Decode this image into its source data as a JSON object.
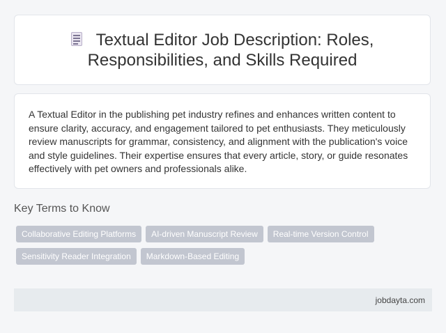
{
  "header": {
    "icon": "document-icon",
    "title": "Textual Editor Job Description: Roles, Responsibilities, and Skills Required"
  },
  "description": {
    "text": "A Textual Editor in the publishing pet industry refines and enhances written content to ensure clarity, accuracy, and engagement tailored to pet enthusiasts. They meticulously review manuscripts for grammar, consistency, and alignment with the publication's voice and style guidelines. Their expertise ensures that every article, story, or guide resonates effectively with pet owners and professionals alike."
  },
  "key_terms": {
    "heading": "Key Terms to Know",
    "items": [
      {
        "label": "Collaborative Editing Platforms"
      },
      {
        "label": "AI-driven Manuscript Review"
      },
      {
        "label": "Real-time Version Control"
      },
      {
        "label": "Sensitivity Reader Integration"
      },
      {
        "label": "Markdown-Based Editing"
      }
    ]
  },
  "footer": {
    "site": "jobdayta.com"
  },
  "colors": {
    "page_background": "#f5f6f8",
    "card_background": "#ffffff",
    "tag_background": "#c2c6d0",
    "footer_background": "#e7ebee"
  }
}
